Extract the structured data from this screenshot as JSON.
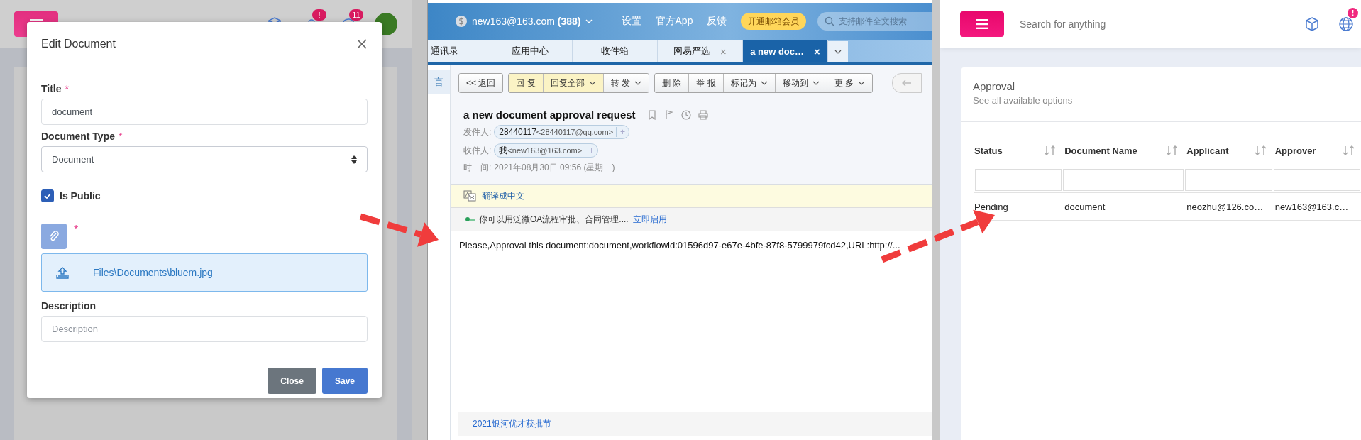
{
  "edit_panel": {
    "topbar": {
      "badges": [
        "!",
        "11"
      ]
    },
    "modal": {
      "title": "Edit Document",
      "fields": [
        {
          "kind": "text",
          "label": "Title",
          "mark": "*",
          "value": "document"
        },
        {
          "kind": "select",
          "label": "Document Type",
          "mark": "*",
          "value": "Document"
        },
        {
          "kind": "checkbox",
          "label": "Is Public",
          "checked": true
        },
        {
          "kind": "file",
          "mark": "*",
          "file": "Files\\Documents\\bluem.jpg"
        },
        {
          "kind": "text",
          "label": "Description",
          "placeholder": "Description"
        }
      ],
      "buttons": [
        {
          "label": "Close",
          "kind": "secondary"
        },
        {
          "label": "Save",
          "kind": "primary"
        }
      ]
    }
  },
  "mail_panel": {
    "account": "new163@163.com",
    "unread": "(388)",
    "links": [
      "设置",
      "官方App",
      "反馈"
    ],
    "vip_button": "开通邮箱会员",
    "search": {
      "placeholder": "支持邮件全文搜索"
    },
    "tabs": [
      {
        "label": "通讯录",
        "selected": false
      },
      {
        "label": "应用中心",
        "selected": false
      },
      {
        "label": "收件箱",
        "selected": false
      },
      {
        "label": "网易严选",
        "selected": false,
        "close": "×"
      },
      {
        "label": "a new doc…",
        "selected": true,
        "close": "×"
      }
    ],
    "sidebar": {
      "items": [
        "言"
      ]
    },
    "toolbar": [
      [
        {
          "label": "<< 返回",
          "highlighted": false,
          "dropdown": false
        }
      ],
      [
        {
          "label": "回 复",
          "highlighted": true,
          "dropdown": false
        },
        {
          "label": "回复全部",
          "highlighted": true,
          "dropdown": true
        },
        {
          "label": "转 发",
          "highlighted": false,
          "dropdown": true
        }
      ],
      [
        {
          "label": "删 除",
          "highlighted": false,
          "dropdown": false
        },
        {
          "label": "举 报",
          "highlighted": false,
          "dropdown": false
        },
        {
          "label": "标记为",
          "highlighted": false,
          "dropdown": true
        },
        {
          "label": "移动到",
          "highlighted": false,
          "dropdown": true
        },
        {
          "label": "更 多",
          "highlighted": false,
          "dropdown": true
        }
      ]
    ],
    "subject": "a new document approval request",
    "meta": [
      {
        "label": "发件人:",
        "name": "28440117",
        "address": "<28440117@qq.com>",
        "add": "+"
      },
      {
        "label": "收件人:",
        "name": "我",
        "address": "<new163@163.com>",
        "add": "+"
      },
      {
        "label": "时　间:",
        "value": "2021年08月30日 09:56 (星期一)"
      }
    ],
    "translate": "翻译成中文",
    "promo": {
      "text": "你可以用泛微OA流程审批、合同管理....",
      "link": "立即启用"
    },
    "body": "Please,Approval this document:document,workflowid:01596d97-e67e-4bfe-87f8-5799979fcd42,URL:http://...",
    "footer_link": "2021银河优才获批节"
  },
  "approval_panel": {
    "search": {
      "placeholder": "Search for anything"
    },
    "badge": "!",
    "card": {
      "title": "Approval",
      "subtitle": "See all available options"
    },
    "table": {
      "columns": [
        "Status",
        "Document Name",
        "Applicant",
        "Approver"
      ],
      "rows": [
        [
          "Pending",
          "document",
          "neozhu@126.co…",
          "new163@163.c…"
        ]
      ]
    }
  }
}
